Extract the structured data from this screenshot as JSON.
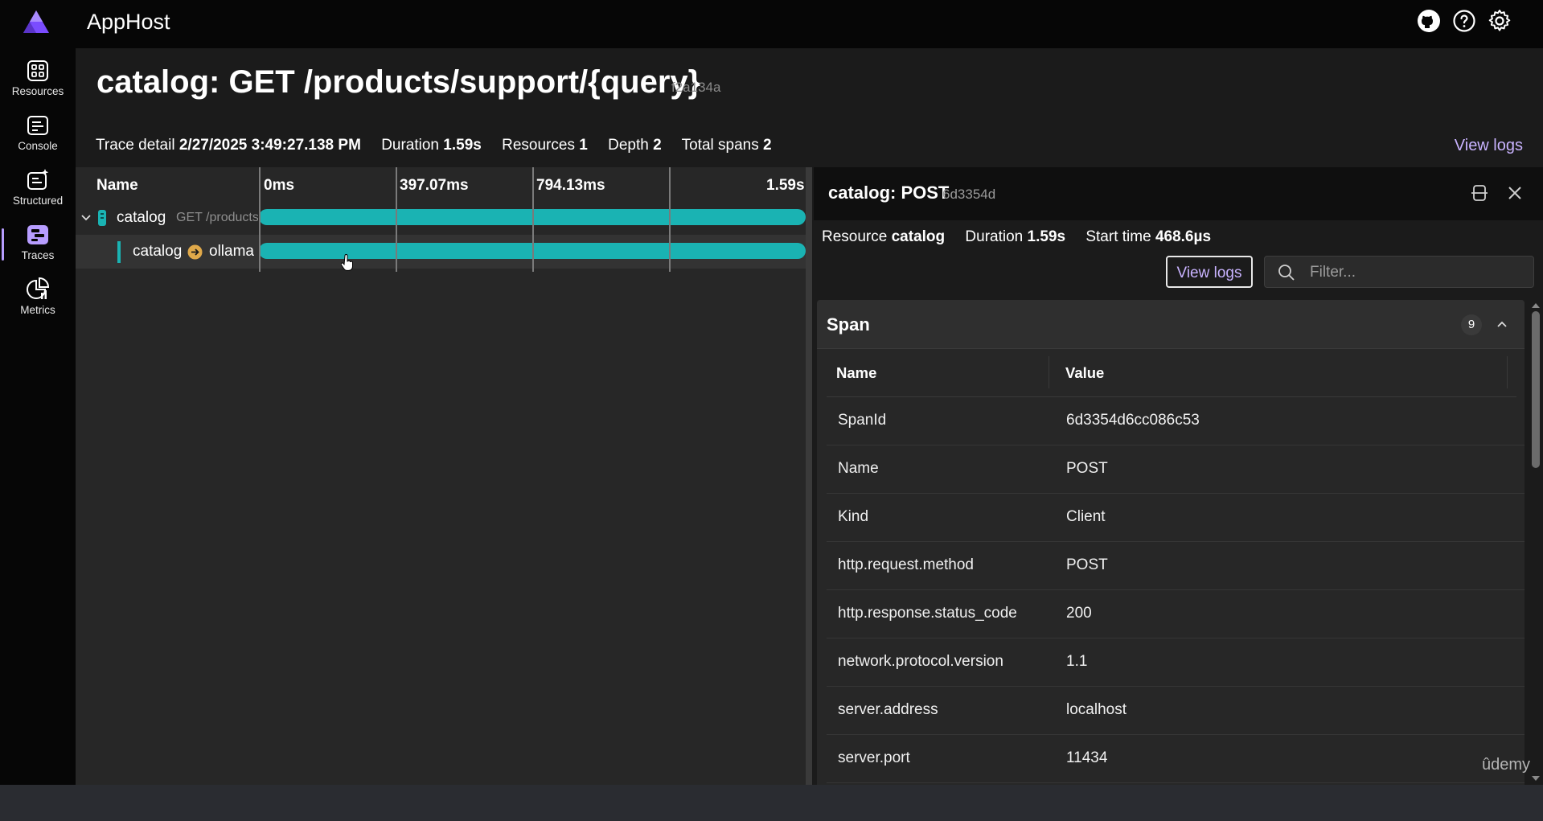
{
  "app": {
    "title": "AppHost"
  },
  "colors": {
    "accent": "#c9b3ff",
    "span_bar": "#1ab3b3",
    "brand": "#7a4cff"
  },
  "top_icons": [
    "github-icon",
    "help-icon",
    "settings-icon"
  ],
  "sidebar": {
    "items": [
      {
        "label": "Resources",
        "icon": "resources-grid-icon"
      },
      {
        "label": "Console",
        "icon": "console-icon"
      },
      {
        "label": "Structured",
        "icon": "structured-logs-icon"
      },
      {
        "label": "Traces",
        "icon": "traces-icon",
        "active": true
      },
      {
        "label": "Metrics",
        "icon": "metrics-icon"
      }
    ]
  },
  "page": {
    "title": "catalog: GET /products/support/{query}",
    "trace_id": "f2a134a",
    "summary": {
      "trace_detail_label": "Trace detail",
      "trace_detail_value": "2/27/2025 3:49:27.138 PM",
      "duration_label": "Duration",
      "duration_value": "1.59s",
      "resources_label": "Resources",
      "resources_value": "1",
      "depth_label": "Depth",
      "depth_value": "2",
      "total_spans_label": "Total spans",
      "total_spans_value": "2"
    },
    "view_logs": "View logs"
  },
  "trace_grid": {
    "name_header": "Name",
    "ticks": [
      "0ms",
      "397.07ms",
      "794.13ms",
      "1.59s"
    ],
    "spans": [
      {
        "resource": "catalog",
        "name": "GET /products",
        "start_fraction": 0,
        "end_fraction": 1
      },
      {
        "resource": "catalog",
        "target": "ollama",
        "start_fraction": 0,
        "end_fraction": 1
      }
    ]
  },
  "detail": {
    "title": "catalog: POST",
    "span_id": "6d3354d",
    "resource_label": "Resource",
    "resource_value": "catalog",
    "duration_label": "Duration",
    "duration_value": "1.59s",
    "start_label": "Start time",
    "start_value": "468.6µs",
    "view_logs": "View logs",
    "filter_placeholder": "Filter...",
    "filter_value": "",
    "section_title": "Span",
    "section_count": "9",
    "col_name": "Name",
    "col_value": "Value",
    "rows": [
      {
        "name": "SpanId",
        "value": "6d3354d6cc086c53"
      },
      {
        "name": "Name",
        "value": "POST"
      },
      {
        "name": "Kind",
        "value": "Client"
      },
      {
        "name": "http.request.method",
        "value": "POST"
      },
      {
        "name": "http.response.status_code",
        "value": "200"
      },
      {
        "name": "network.protocol.version",
        "value": "1.1"
      },
      {
        "name": "server.address",
        "value": "localhost"
      },
      {
        "name": "server.port",
        "value": "11434"
      }
    ]
  },
  "watermark": "ûdemy"
}
